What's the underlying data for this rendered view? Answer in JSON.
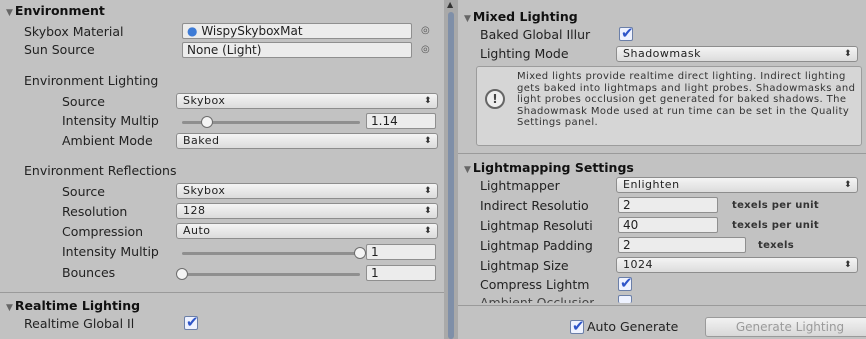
{
  "environment": {
    "header": "Environment",
    "skybox_label": "Skybox Material",
    "skybox_value": "WispySkyboxMat",
    "sun_label": "Sun Source",
    "sun_value": "None (Light)",
    "lighting_header": "Environment Lighting",
    "source_label": "Source",
    "source_value": "Skybox",
    "intensity_label": "Intensity Multip",
    "intensity_value": "1.14",
    "intensity_fraction": 0.14,
    "ambient_label": "Ambient Mode",
    "ambient_value": "Baked",
    "reflections_header": "Environment Reflections",
    "refl_source_label": "Source",
    "refl_source_value": "Skybox",
    "resolution_label": "Resolution",
    "resolution_value": "128",
    "compression_label": "Compression",
    "compression_value": "Auto",
    "refl_intensity_label": "Intensity Multip",
    "refl_intensity_value": "1",
    "refl_intensity_fraction": 1.0,
    "bounces_label": "Bounces",
    "bounces_value": "1",
    "bounces_fraction": 0.0
  },
  "realtime": {
    "header": "Realtime Lighting",
    "gi_label": "Realtime Global Il",
    "gi_checked": true
  },
  "mixed": {
    "header": "Mixed Lighting",
    "baked_gi_label": "Baked Global Illur",
    "baked_gi_checked": true,
    "mode_label": "Lighting Mode",
    "mode_value": "Shadowmask",
    "help_text": "Mixed lights provide realtime direct lighting. Indirect lighting gets baked into lightmaps and light probes. Shadowmasks and light probes occlusion get generated for baked shadows. The Shadowmask Mode used at run time can be set in the Quality Settings panel.",
    "help_icon": "info-icon"
  },
  "lightmapping": {
    "header": "Lightmapping Settings",
    "lightmapper_label": "Lightmapper",
    "lightmapper_value": "Enlighten",
    "indirect_label": "Indirect Resolutio",
    "indirect_value": "2",
    "indirect_unit": "texels per unit",
    "lm_res_label": "Lightmap Resoluti",
    "lm_res_value": "40",
    "lm_res_unit": "texels per unit",
    "padding_label": "Lightmap Padding",
    "padding_value": "2",
    "padding_unit": "texels",
    "size_label": "Lightmap Size",
    "size_value": "1024",
    "compress_label": "Compress Lightm",
    "compress_checked": true,
    "ao_label": "Ambient Occlusior"
  },
  "footer": {
    "auto_label": "Auto Generate",
    "auto_checked": true,
    "generate_label": "Generate Lighting"
  },
  "colors": {
    "background": "#c2c2c2",
    "field": "#ececec",
    "check": "#2e55c9"
  }
}
